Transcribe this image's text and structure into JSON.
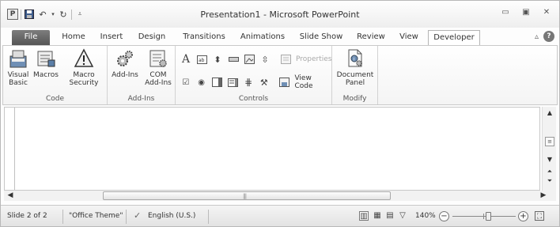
{
  "window": {
    "title": "Presentation1  -  Microsoft PowerPoint",
    "app_logo": "P"
  },
  "qat": {
    "icons": [
      "powerpoint-logo",
      "save-icon",
      "undo-icon",
      "redo-icon",
      "customize-qat-icon"
    ]
  },
  "tabs": [
    {
      "label": "File"
    },
    {
      "label": "Home"
    },
    {
      "label": "Insert"
    },
    {
      "label": "Design"
    },
    {
      "label": "Transitions"
    },
    {
      "label": "Animations"
    },
    {
      "label": "Slide Show"
    },
    {
      "label": "Review"
    },
    {
      "label": "View"
    },
    {
      "label": "Developer",
      "active": true
    }
  ],
  "ribbon": {
    "groups": {
      "code": {
        "label": "Code",
        "visual_basic": "Visual\nBasic",
        "macros": "Macros",
        "macro_security": "Macro\nSecurity"
      },
      "addins": {
        "label": "Add-Ins",
        "addins": "Add-Ins",
        "com_addins": "COM\nAdd-Ins"
      },
      "controls": {
        "label": "Controls",
        "properties": "Properties",
        "view_code": "View Code"
      },
      "modify": {
        "label": "Modify",
        "document_panel": "Document\nPanel"
      }
    }
  },
  "statusbar": {
    "slide": "Slide 2 of 2",
    "theme": "\"Office Theme\"",
    "language": "English (U.S.)",
    "zoom": "140%"
  },
  "colors": {
    "file_tab": "#5f5f5f",
    "ribbon_bg": "#f7f7f7"
  }
}
